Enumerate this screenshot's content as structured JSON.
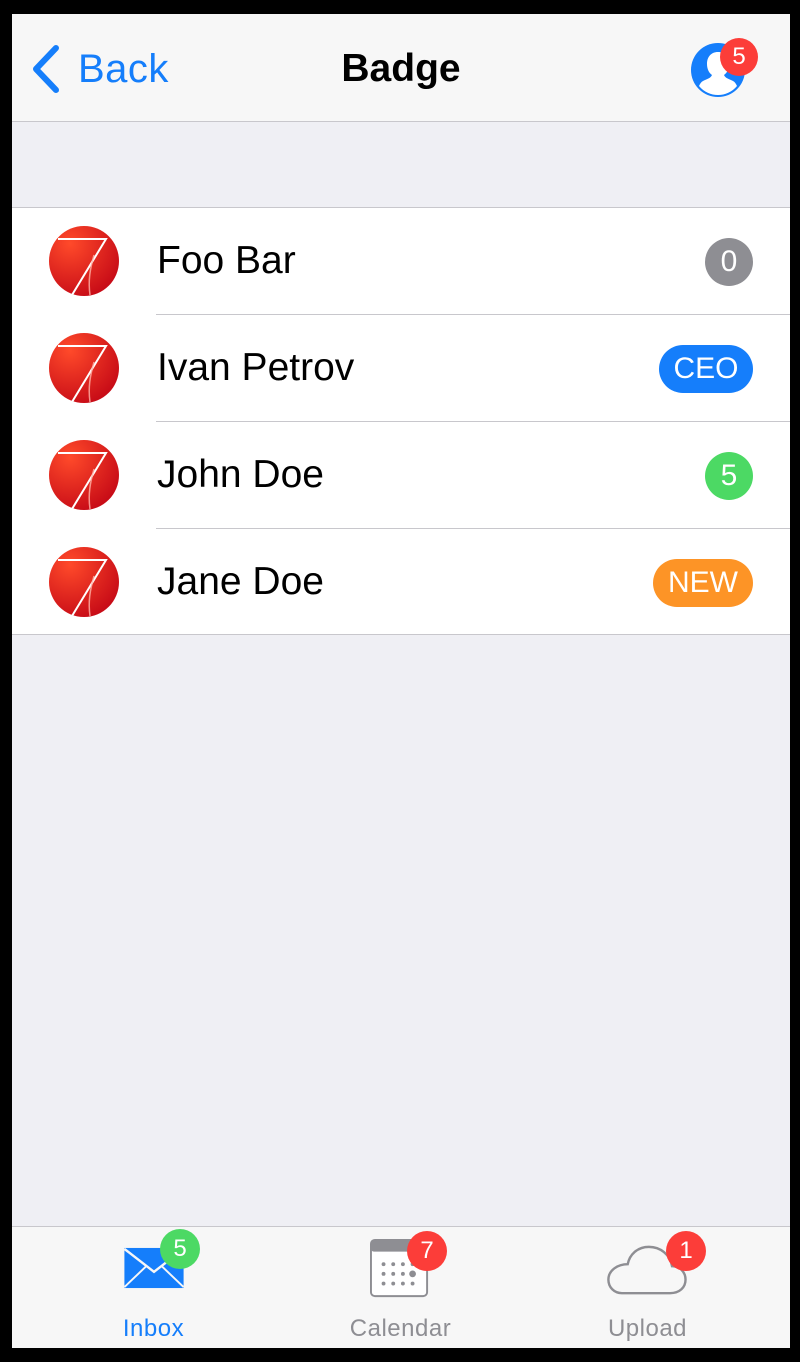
{
  "nav": {
    "back_label": "Back",
    "title": "Badge",
    "profile_badge": "5"
  },
  "colors": {
    "accent": "#157efb",
    "badge_red": "#fc3d39",
    "badge_gray": "#8e8e93",
    "badge_blue": "#157efb",
    "badge_green": "#4cd964",
    "badge_orange": "#fd9426"
  },
  "rows": [
    {
      "name": "Foo Bar",
      "badge": "0",
      "badge_color": "#8e8e93",
      "icon": "app-logo-icon"
    },
    {
      "name": "Ivan Petrov",
      "badge": "CEO",
      "badge_color": "#157efb",
      "icon": "app-logo-icon"
    },
    {
      "name": "John Doe",
      "badge": "5",
      "badge_color": "#4cd964",
      "icon": "app-logo-icon"
    },
    {
      "name": "Jane Doe",
      "badge": "NEW",
      "badge_color": "#fd9426",
      "icon": "app-logo-icon"
    }
  ],
  "tabs": [
    {
      "label": "Inbox",
      "badge": "5",
      "badge_color": "#4cd964",
      "icon": "envelope-icon",
      "selected": true
    },
    {
      "label": "Calendar",
      "badge": "7",
      "badge_color": "#fc3d39",
      "icon": "calendar-icon",
      "selected": false
    },
    {
      "label": "Upload",
      "badge": "1",
      "badge_color": "#fc3d39",
      "icon": "cloud-icon",
      "selected": false
    }
  ]
}
